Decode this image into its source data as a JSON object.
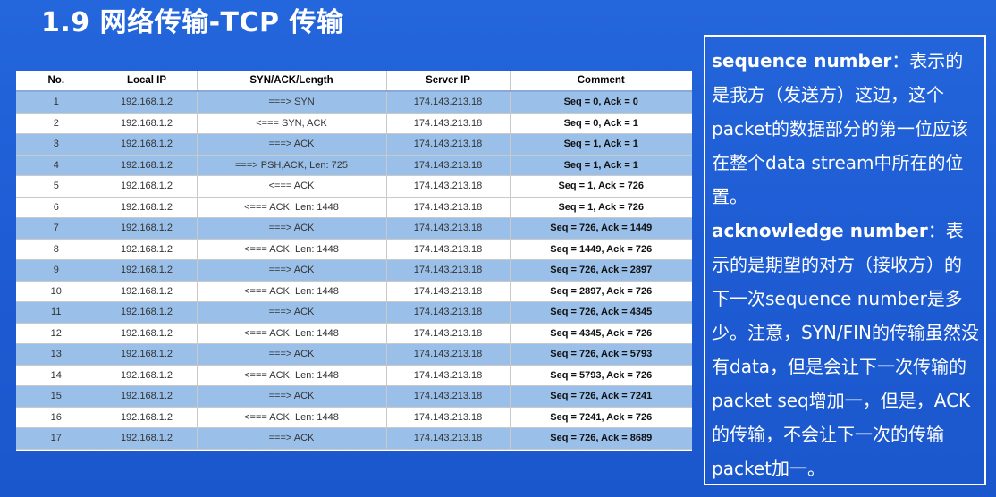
{
  "title": "1.9 网络传输-TCP 传输",
  "table": {
    "headers": [
      "No.",
      "Local IP",
      "SYN/ACK/Length",
      "Server IP",
      "Comment"
    ],
    "rows": [
      [
        "1",
        "192.168.1.2",
        "===> SYN",
        "174.143.213.18",
        "Seq = 0, Ack = 0"
      ],
      [
        "2",
        "192.168.1.2",
        "<=== SYN, ACK",
        "174.143.213.18",
        "Seq = 0, Ack = 1"
      ],
      [
        "3",
        "192.168.1.2",
        "===> ACK",
        "174.143.213.18",
        "Seq = 1, Ack = 1"
      ],
      [
        "4",
        "192.168.1.2",
        "===> PSH,ACK, Len: 725",
        "174.143.213.18",
        "Seq = 1, Ack = 1"
      ],
      [
        "5",
        "192.168.1.2",
        "<=== ACK",
        "174.143.213.18",
        "Seq = 1, Ack = 726"
      ],
      [
        "6",
        "192.168.1.2",
        "<=== ACK, Len: 1448",
        "174.143.213.18",
        "Seq = 1, Ack = 726"
      ],
      [
        "7",
        "192.168.1.2",
        "===> ACK",
        "174.143.213.18",
        "Seq = 726, Ack = 1449"
      ],
      [
        "8",
        "192.168.1.2",
        "<=== ACK, Len: 1448",
        "174.143.213.18",
        "Seq = 1449, Ack = 726"
      ],
      [
        "9",
        "192.168.1.2",
        "===> ACK",
        "174.143.213.18",
        "Seq = 726, Ack = 2897"
      ],
      [
        "10",
        "192.168.1.2",
        "<=== ACK, Len: 1448",
        "174.143.213.18",
        "Seq = 2897, Ack = 726"
      ],
      [
        "11",
        "192.168.1.2",
        "===> ACK",
        "174.143.213.18",
        "Seq = 726, Ack = 4345"
      ],
      [
        "12",
        "192.168.1.2",
        "<=== ACK, Len: 1448",
        "174.143.213.18",
        "Seq = 4345, Ack = 726"
      ],
      [
        "13",
        "192.168.1.2",
        "===> ACK",
        "174.143.213.18",
        "Seq = 726, Ack = 5793"
      ],
      [
        "14",
        "192.168.1.2",
        "<=== ACK, Len: 1448",
        "174.143.213.18",
        "Seq = 5793, Ack = 726"
      ],
      [
        "15",
        "192.168.1.2",
        "===> ACK",
        "174.143.213.18",
        "Seq = 726, Ack = 7241"
      ],
      [
        "16",
        "192.168.1.2",
        "<=== ACK, Len: 1448",
        "174.143.213.18",
        "Seq = 7241, Ack = 726"
      ],
      [
        "17",
        "192.168.1.2",
        "===> ACK",
        "174.143.213.18",
        "Seq = 726, Ack = 8689"
      ]
    ],
    "row_colors": [
      "blue",
      "white",
      "blue",
      "blue",
      "white",
      "white",
      "blue",
      "white",
      "blue",
      "white",
      "blue",
      "white",
      "blue",
      "white",
      "blue",
      "white",
      "blue"
    ]
  },
  "note": {
    "seq_term": "sequence number",
    "seq_text": "：表示的是我方（发送方）这边，这个packet的数据部分的第一位应该在整个data stream中所在的位置。",
    "ack_term": "acknowledge number",
    "ack_text": "：表示的是期望的对方（接收方）的下一次sequence number是多少。注意，SYN/FIN的传输虽然没有data，但是会让下一次传输的packet seq增加一，但是，ACK的传输，不会让下一次的传输packet加一。"
  },
  "colors": {
    "background": "#1f5fd6",
    "row_blue": "#9ac0ea",
    "row_white": "#ffffff"
  }
}
